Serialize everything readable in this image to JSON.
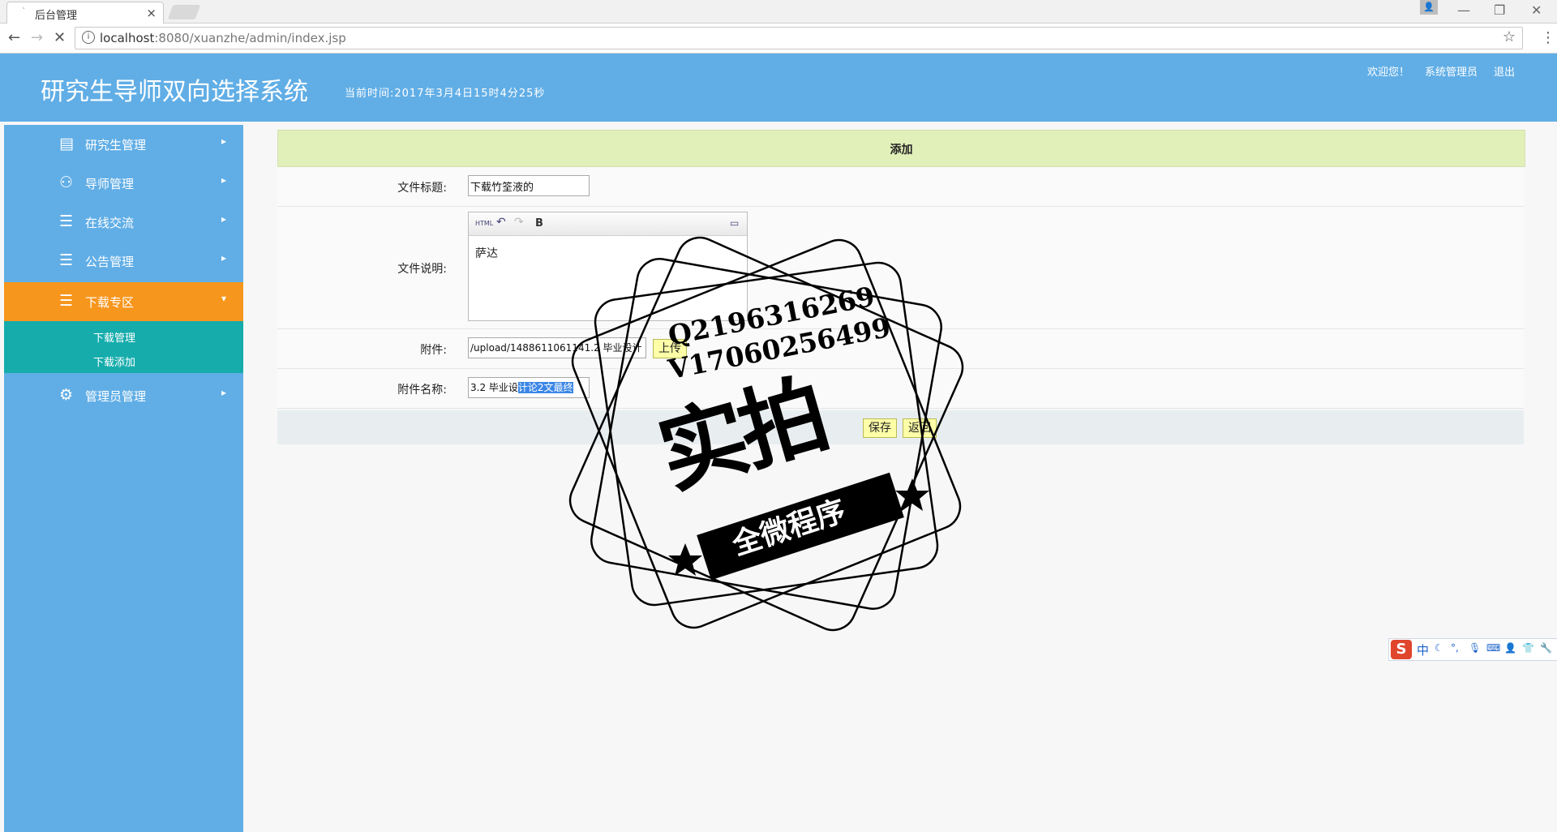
{
  "browser": {
    "tab_title": "后台管理",
    "tab_close": "×",
    "url_host": "localhost",
    "url_rest": ":8080/xuanzhe/admin/index.jsp",
    "back": "←",
    "forward": "→",
    "reload": "✕",
    "info": "i",
    "star": "☆",
    "menu": "⋮",
    "win_min": "—",
    "win_max": "❐",
    "win_close": "✕"
  },
  "header": {
    "title": "研究生导师双向选择系统",
    "current_time": "当前时间:2017年3月4日15时4分25秒",
    "welcome": "欢迎您！",
    "role": "系统管理员",
    "logout": "退出"
  },
  "sidebar": {
    "items": [
      {
        "label": "研究生管理",
        "icon": "▤"
      },
      {
        "label": "导师管理",
        "icon": "⚇"
      },
      {
        "label": "在线交流",
        "icon": "☰"
      },
      {
        "label": "公告管理",
        "icon": "☰"
      },
      {
        "label": "下载专区",
        "icon": "☰"
      },
      {
        "label": "管理员管理",
        "icon": "⚙"
      }
    ],
    "arrow": "▸",
    "arrow_open": "▾",
    "submenu": [
      "下载管理",
      "下载添加"
    ]
  },
  "form": {
    "heading": "添加",
    "title_label": "文件标题:",
    "title_value": "下载竹筌液的",
    "desc_label": "文件说明:",
    "desc_value": "萨达",
    "toolbar": {
      "html": "HTML",
      "undo": "↶",
      "redo": "↷",
      "bold": "B",
      "fullscreen": "▭"
    },
    "attach_label": "附件:",
    "attach_value": "/upload/1488611061141.2 毕业设计",
    "upload_btn": "上传",
    "attach_name_label": "附件名称:",
    "attach_name_plain": "3.2 毕业设",
    "attach_name_selected": "计论2文最终",
    "submit_btn": "保存",
    "back_btn": "返回"
  },
  "watermark": {
    "qq": "Q2196316269",
    "wechat": "V17060256499",
    "main": "实拍",
    "band": "全微程序"
  },
  "ime": {
    "logo": "S",
    "mode": "中"
  }
}
